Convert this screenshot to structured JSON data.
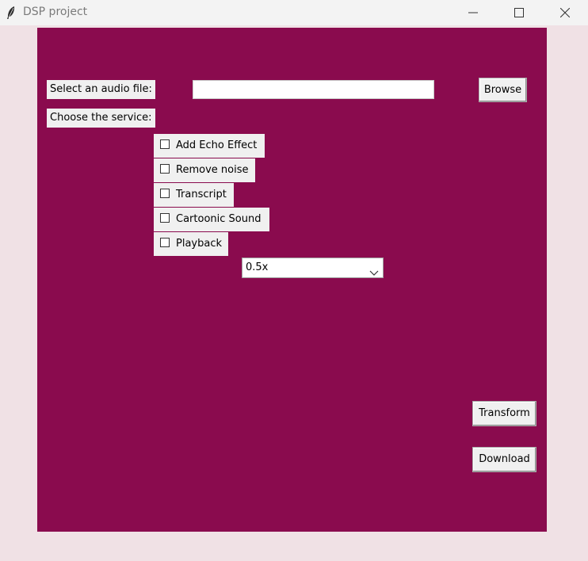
{
  "window": {
    "title": "DSP project",
    "icon": "feather-icon",
    "controls": [
      "minimize-icon",
      "maximize-icon",
      "close-icon"
    ]
  },
  "colors": {
    "panel": "#8a0b4e",
    "outer_background": "#f0e1e5"
  },
  "form": {
    "file_label": "Select an audio file:",
    "file_value": "",
    "browse_label": "Browse",
    "service_label": "Choose the service:",
    "services": [
      {
        "label": "Add Echo Effect",
        "checked": false
      },
      {
        "label": "Remove noise",
        "checked": false
      },
      {
        "label": "Transcript",
        "checked": false
      },
      {
        "label": "Cartoonic Sound",
        "checked": false
      },
      {
        "label": "Playback",
        "checked": false
      }
    ],
    "speed": {
      "selected": "0.5x"
    },
    "transform_label": "Transform",
    "download_label": "Download"
  }
}
